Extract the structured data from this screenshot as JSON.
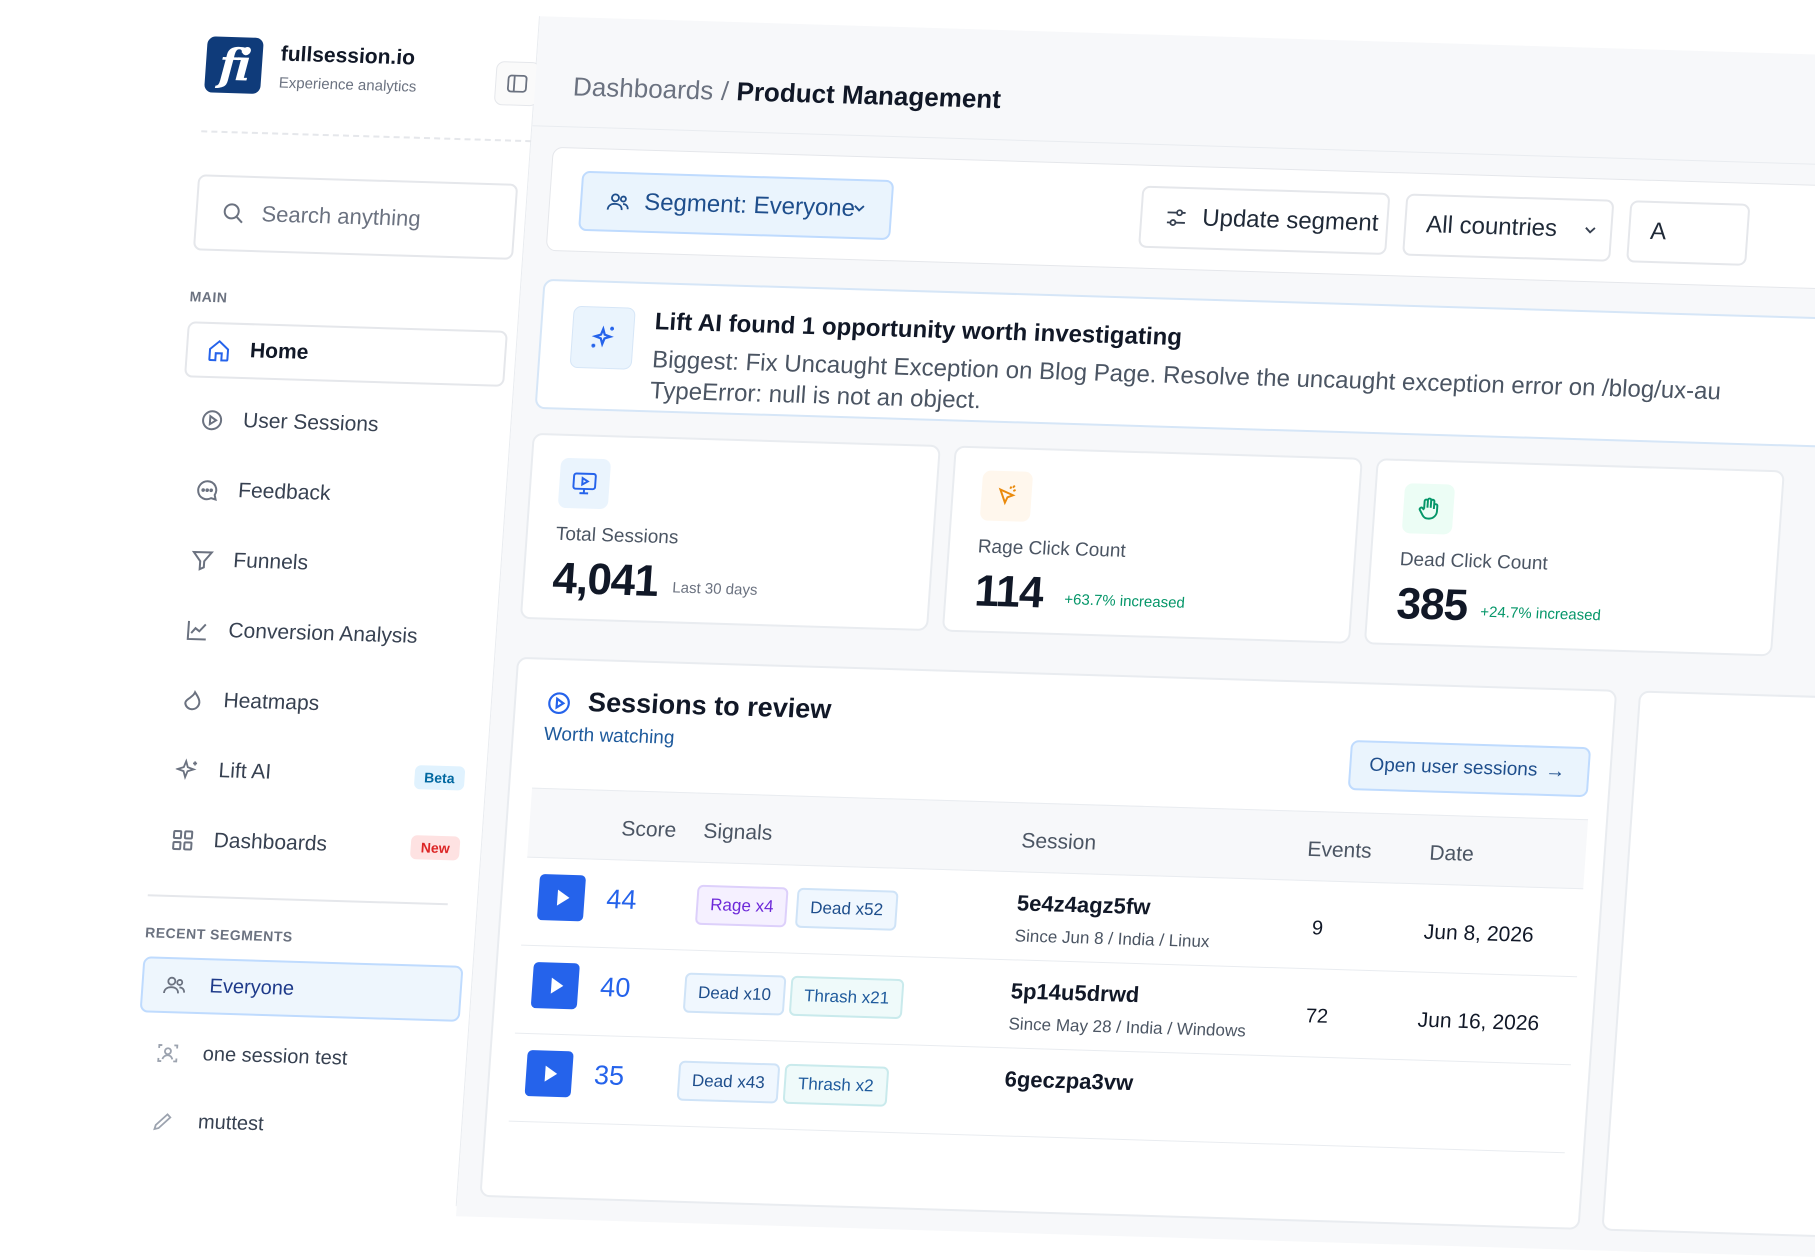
{
  "brand": {
    "logo_text": "fi",
    "name": "fullsession.io",
    "tagline": "Experience analytics"
  },
  "search": {
    "placeholder": "Search anything"
  },
  "sidebar": {
    "main_label": "MAIN",
    "items": [
      {
        "label": "Home",
        "icon": "home-icon",
        "active": true
      },
      {
        "label": "User Sessions",
        "icon": "play-circle-icon"
      },
      {
        "label": "Feedback",
        "icon": "chat-icon"
      },
      {
        "label": "Funnels",
        "icon": "funnel-icon"
      },
      {
        "label": "Conversion Analysis",
        "icon": "chart-line-icon"
      },
      {
        "label": "Heatmaps",
        "icon": "flame-icon"
      },
      {
        "label": "Lift AI",
        "icon": "sparkles-icon",
        "badge": "Beta"
      },
      {
        "label": "Dashboards",
        "icon": "grid-icon",
        "badge": "New"
      }
    ],
    "recent_label": "RECENT SEGMENTS",
    "segments": [
      {
        "label": "Everyone",
        "icon": "users-icon",
        "active": true
      },
      {
        "label": "one session test",
        "icon": "user-scan-icon"
      },
      {
        "label": "muttest",
        "icon": "pencil-icon"
      }
    ]
  },
  "header": {
    "breadcrumb_parent": "Dashboards",
    "breadcrumb_sep": "/",
    "breadcrumb_current": "Product Management"
  },
  "filters": {
    "segment_label": "Segment: Everyone",
    "update_label": "Update segment",
    "countries_label": "All countries",
    "more_label": "A"
  },
  "ai_banner": {
    "title": "Lift AI found 1 opportunity worth investigating",
    "line1": "Biggest: Fix Uncaught Exception on Blog Page. Resolve the uncaught exception error on /blog/ux-au",
    "line2": "TypeError: null is not an object."
  },
  "stats": {
    "total": {
      "label": "Total Sessions",
      "value": "4,041",
      "sub": "Last 30 days"
    },
    "rage": {
      "label": "Rage Click Count",
      "value": "114",
      "sub": "+63.7% increased"
    },
    "dead": {
      "label": "Dead Click Count",
      "value": "385",
      "sub": "+24.7% increased"
    }
  },
  "sessions": {
    "title": "Sessions to review",
    "subtitle": "Worth watching",
    "open_button": "Open user sessions",
    "columns": {
      "score": "Score",
      "signals": "Signals",
      "session": "Session",
      "events": "Events",
      "date": "Date"
    },
    "rows": [
      {
        "score": "44",
        "tag1": "Rage x4",
        "tag2": "Dead x52",
        "id": "5e4z4agz5fw",
        "meta": "Since Jun 8 / India / Linux",
        "events": "9",
        "date": "Jun 8, 2026"
      },
      {
        "score": "40",
        "tag1": "Dead x10",
        "tag2": "Thrash x21",
        "id": "5p14u5drwd",
        "meta": "Since May 28 / India / Windows",
        "events": "72",
        "date": "Jun 16, 2026"
      },
      {
        "score": "35",
        "tag1": "Dead x43",
        "tag2": "Thrash x2",
        "id": "6geczpa3vw",
        "meta": "",
        "events": "",
        "date": ""
      }
    ]
  },
  "colors": {
    "accent": "#2563eb",
    "brand_navy": "#0f3b7a",
    "positive": "#059669",
    "new_badge": "#dc2626"
  }
}
